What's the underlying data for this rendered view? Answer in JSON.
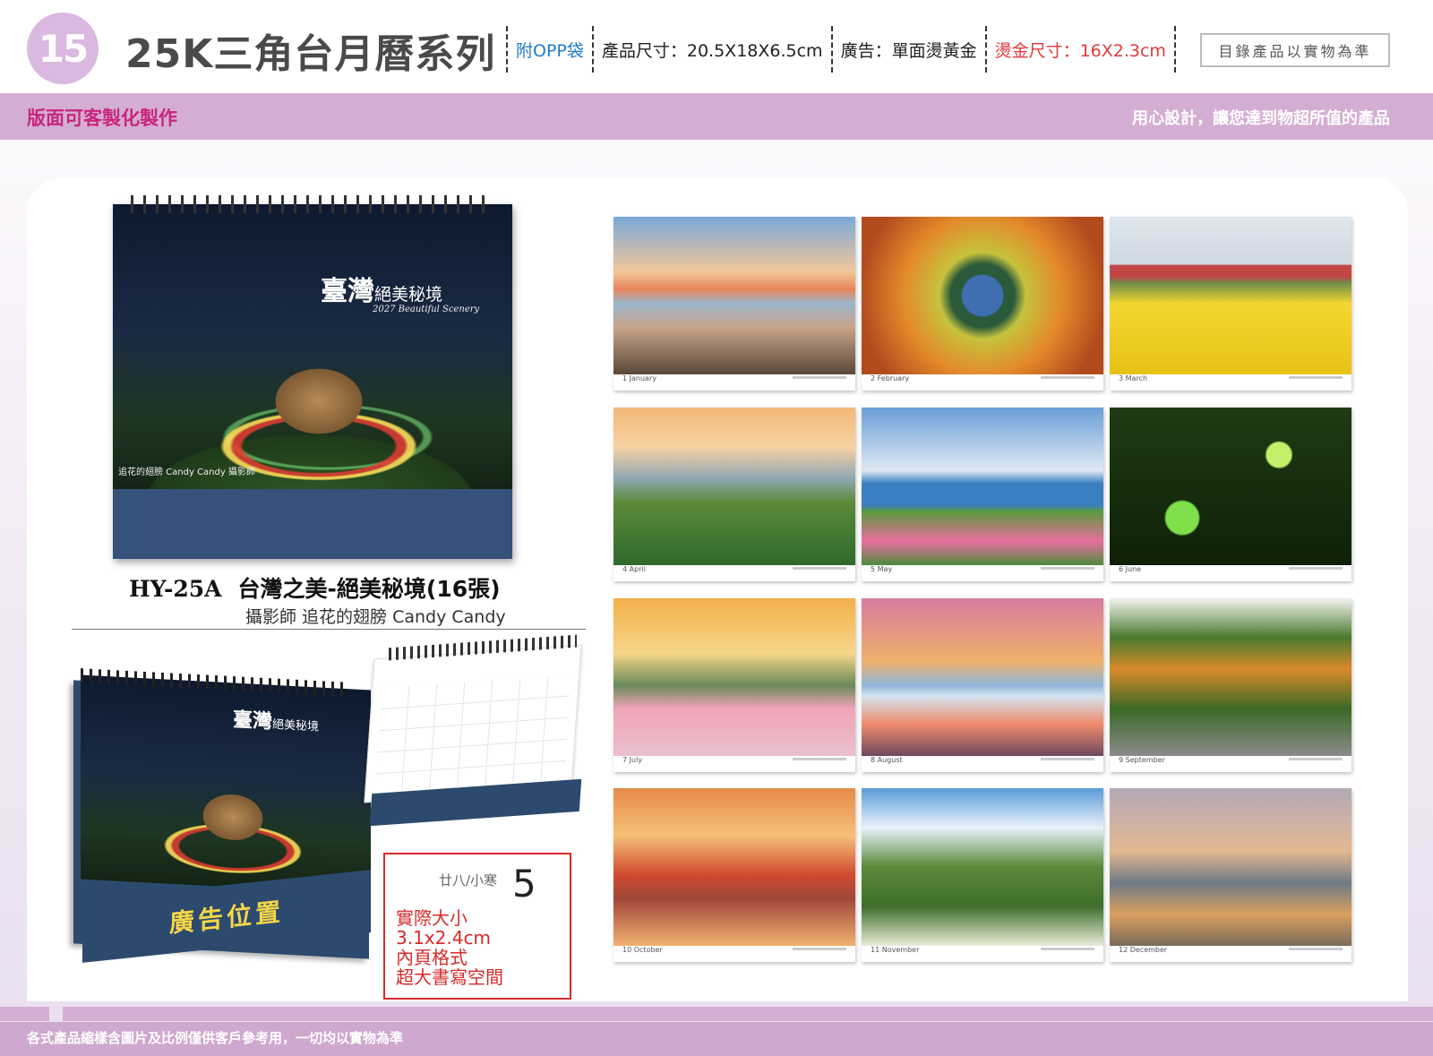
{
  "header": {
    "page_number": "15",
    "series_title": "25K三角台月曆系列",
    "specs": [
      {
        "text": "附OPP袋",
        "color": "#1f7ac7"
      },
      {
        "text": "產品尺寸：20.5X18X6.5cm",
        "color": "#222222"
      },
      {
        "text": "廣告：單面燙黃金",
        "color": "#222222"
      },
      {
        "text": "燙金尺寸：16X2.3cm",
        "color": "#e23a3a"
      }
    ],
    "catalog_note": "目錄產品以實物為準"
  },
  "band": {
    "left": "版面可客製化製作",
    "right": "用心設計，讓您達到物超所值的產品"
  },
  "product": {
    "cover_logo_main": "臺灣",
    "cover_logo_small": "絕美秘境",
    "cover_logo_sub": "2027 Beautiful Scenery",
    "cover_credit": "追花的翅膀 Candy Candy 攝影師",
    "code": "HY-25A",
    "name": "台灣之美-絕美秘境(16張)",
    "photographer": "攝影師 追花的翅膀 Candy Candy",
    "ad_position": "廣告位置"
  },
  "callout": {
    "lunar_date": "廿八/小寒",
    "day": "5",
    "lines": [
      "實際大小",
      "3.1x2.4cm",
      "內頁格式",
      "超大書寫空間"
    ]
  },
  "months": [
    {
      "num": "1",
      "name": "January"
    },
    {
      "num": "2",
      "name": "February"
    },
    {
      "num": "3",
      "name": "March"
    },
    {
      "num": "4",
      "name": "April"
    },
    {
      "num": "5",
      "name": "May"
    },
    {
      "num": "6",
      "name": "June"
    },
    {
      "num": "7",
      "name": "July"
    },
    {
      "num": "8",
      "name": "August"
    },
    {
      "num": "9",
      "name": "September"
    },
    {
      "num": "10",
      "name": "October"
    },
    {
      "num": "11",
      "name": "November"
    },
    {
      "num": "12",
      "name": "December"
    }
  ],
  "footer": {
    "note": "各式產品縮樣含圖片及比例僅供客戶參考用，一切均以實物為準"
  }
}
